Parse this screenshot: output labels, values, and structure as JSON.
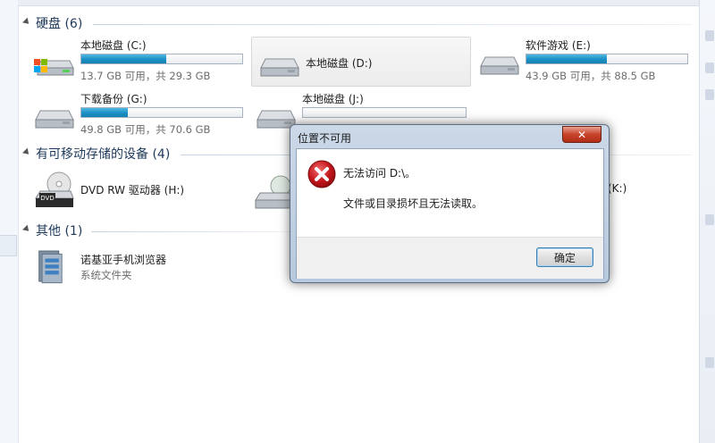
{
  "groups": {
    "hard_disks": {
      "label": "硬盘 (6)"
    },
    "removable": {
      "label": "有可移动存储的设备 (4)"
    },
    "other": {
      "label": "其他 (1)"
    }
  },
  "drives": [
    {
      "name": "本地磁盘 (C:)",
      "free_text": "13.7 GB 可用，共 29.3 GB",
      "used_fraction": 0.53
    },
    {
      "name": "本地磁盘 (D:)",
      "free_text": "",
      "used_fraction": 0
    },
    {
      "name": "软件游戏 (E:)",
      "free_text": "43.9 GB 可用，共 88.5 GB",
      "used_fraction": 0.5
    },
    {
      "name": "下载备份 (G:)",
      "free_text": "49.8 GB 可用，共 70.6 GB",
      "used_fraction": 0.29
    },
    {
      "name": "本地磁盘 (J:)",
      "free_text": "",
      "used_fraction": 0
    }
  ],
  "devices": [
    {
      "name": "DVD RW 驱动器 (H:)"
    },
    {
      "name": "(K:)"
    }
  ],
  "other_items": [
    {
      "name": "诺基亚手机浏览器",
      "type": "系统文件夹"
    }
  ],
  "dialog": {
    "title": "位置不可用",
    "close_symbol": "✕",
    "message_line1": "无法访问 D:\\。",
    "message_line2": "文件或目录损坏且无法读取。",
    "ok_label": "确定"
  },
  "colors": {
    "usage_bar": "#1c8fc4",
    "group_header_text": "#1e395b",
    "error_red": "#c4161c"
  }
}
